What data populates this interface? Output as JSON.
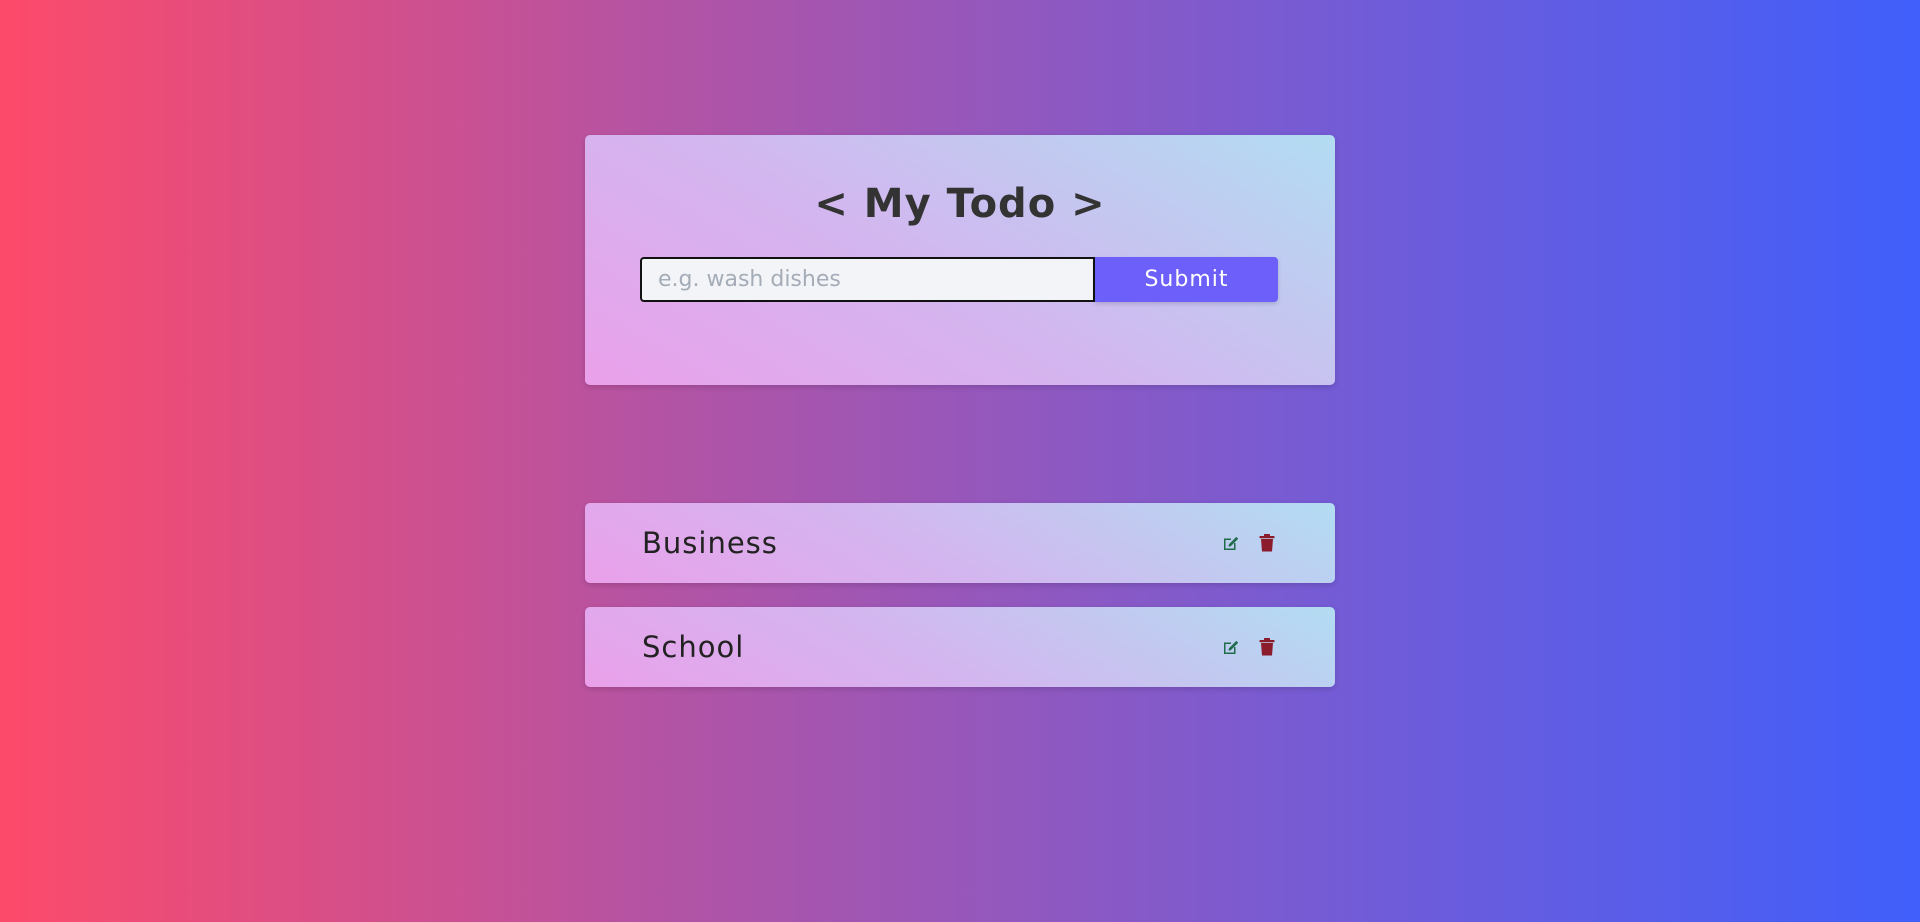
{
  "app": {
    "title": "< My Todo >"
  },
  "form": {
    "input_placeholder": "e.g. wash dishes",
    "input_value": "",
    "submit_label": "Submit"
  },
  "todos": [
    {
      "text": "Business",
      "edit_icon": "edit-icon",
      "delete_icon": "trash-icon"
    },
    {
      "text": "School",
      "edit_icon": "edit-icon",
      "delete_icon": "trash-icon"
    }
  ],
  "colors": {
    "submit_button": "#6d5ff9",
    "edit_icon": "#1f6b4a",
    "delete_icon": "#8b1c2c"
  }
}
